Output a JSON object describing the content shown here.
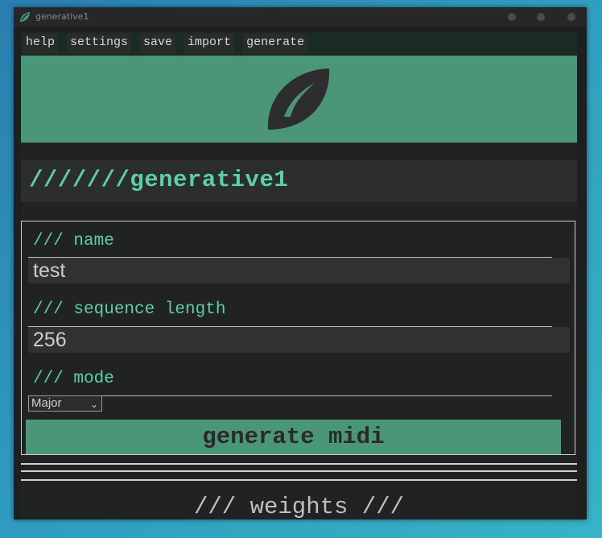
{
  "window": {
    "title": "generative1",
    "icon": "leaf-icon"
  },
  "menu": [
    "help",
    "settings",
    "save",
    "import",
    "generate"
  ],
  "banner": {
    "icon": "leaf-icon",
    "color": "#4b9677"
  },
  "header": {
    "title": "///////generative1"
  },
  "form": {
    "name_label": "/// name",
    "name_value": "test",
    "length_label": "/// sequence length",
    "length_value": "256",
    "mode_label": "/// mode",
    "mode_value": "Major",
    "generate_label": "generate midi"
  },
  "weights": {
    "title": "/// weights ///"
  },
  "colors": {
    "accent": "#5ecfa6",
    "green": "#4b9677",
    "background": "#212223"
  }
}
